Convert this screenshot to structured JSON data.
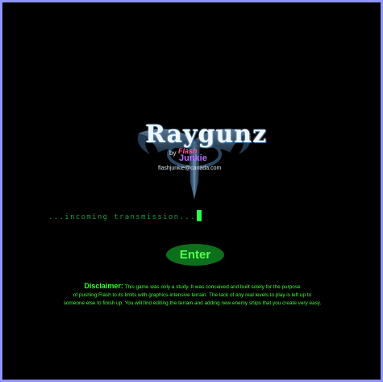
{
  "game": {
    "title": "Raygunz",
    "by_label": "by",
    "author_brand_line1": "Flash",
    "author_brand_line2": "Junkie",
    "author_email": "flashjunkie@canada.com"
  },
  "transmission": {
    "text": "...incoming transmission..."
  },
  "enter_button": {
    "label": "Enter"
  },
  "disclaimer": {
    "label": "Disclaimer:",
    "line1": "This game was only a study. It was conceived and built solely for the purpose",
    "line2": "of pushing Flash to its limits with graphics-intensive terrain. The lack of any real levels to play is left up to",
    "line3": "someone else to finish up. You will find editing the terrain and adding new enemy ships that you create very easy."
  },
  "colors": {
    "background": "#000000",
    "frame_border": "#8f95ff",
    "accent_green": "#39ff2d",
    "button_fill": "#0c6f1c",
    "transmission_text": "#1d9b45",
    "cursor": "#2bff45"
  },
  "icons": {
    "logo_emblem": "winged-cross-emblem"
  }
}
